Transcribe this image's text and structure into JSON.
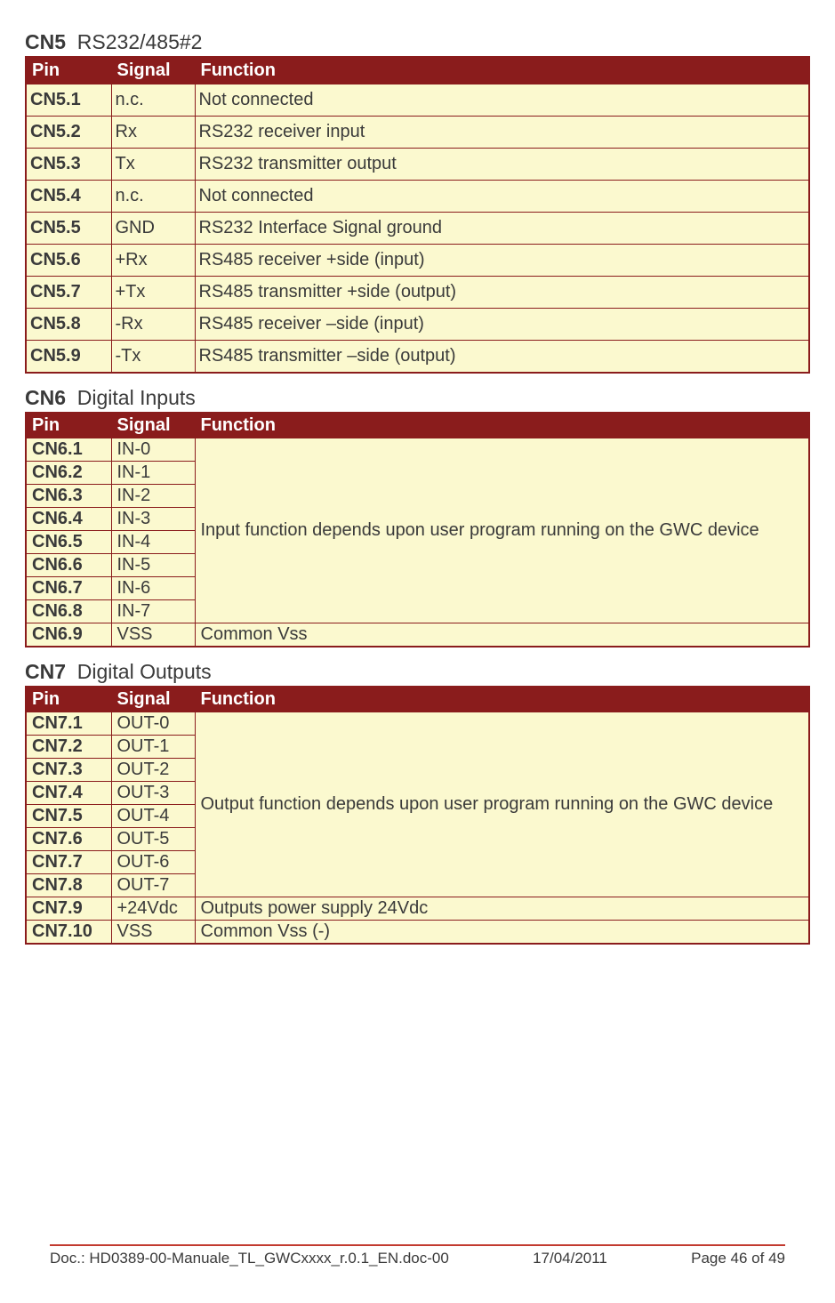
{
  "cn5": {
    "title_bold": "CN5",
    "title_rest": "RS232/485#2",
    "headers": {
      "pin": "Pin",
      "signal": "Signal",
      "func": "Function"
    },
    "rows": [
      {
        "pin": "CN5.1",
        "signal": "n.c.",
        "func": "Not connected"
      },
      {
        "pin": "CN5.2",
        "signal": "Rx",
        "func": "RS232 receiver input"
      },
      {
        "pin": "CN5.3",
        "signal": "Tx",
        "func": "RS232 transmitter output"
      },
      {
        "pin": "CN5.4",
        "signal": "n.c.",
        "func": "Not connected"
      },
      {
        "pin": "CN5.5",
        "signal": "GND",
        "func": "RS232 Interface Signal ground"
      },
      {
        "pin": "CN5.6",
        "signal": "+Rx",
        "func": "RS485 receiver +side (input)"
      },
      {
        "pin": "CN5.7",
        "signal": "+Tx",
        "func": "RS485 transmitter +side (output)"
      },
      {
        "pin": "CN5.8",
        "signal": "-Rx",
        "func": "RS485 receiver  –side (input)"
      },
      {
        "pin": "CN5.9",
        "signal": "-Tx",
        "func": "RS485 transmitter –side (output)"
      }
    ]
  },
  "cn6": {
    "title_bold": "CN6",
    "title_rest": "Digital Inputs",
    "headers": {
      "pin": "Pin",
      "signal": "Signal",
      "func": "Function"
    },
    "merged_func": "Input function depends upon user program running on the GWC device",
    "rows": [
      {
        "pin": "CN6.1",
        "signal": "IN-0"
      },
      {
        "pin": "CN6.2",
        "signal": "IN-1"
      },
      {
        "pin": "CN6.3",
        "signal": "IN-2"
      },
      {
        "pin": "CN6.4",
        "signal": "IN-3"
      },
      {
        "pin": "CN6.5",
        "signal": "IN-4"
      },
      {
        "pin": "CN6.6",
        "signal": "IN-5"
      },
      {
        "pin": "CN6.7",
        "signal": "IN-6"
      },
      {
        "pin": "CN6.8",
        "signal": "IN-7"
      }
    ],
    "last": {
      "pin": "CN6.9",
      "signal": "VSS",
      "func": "Common Vss"
    }
  },
  "cn7": {
    "title_bold": "CN7",
    "title_rest": "Digital Outputs",
    "headers": {
      "pin": "Pin",
      "signal": "Signal",
      "func": "Function"
    },
    "merged_func": "Output function depends upon user program running on the GWC device",
    "rows": [
      {
        "pin": "CN7.1",
        "signal": "OUT-0"
      },
      {
        "pin": "CN7.2",
        "signal": "OUT-1"
      },
      {
        "pin": "CN7.3",
        "signal": "OUT-2"
      },
      {
        "pin": "CN7.4",
        "signal": "OUT-3"
      },
      {
        "pin": "CN7.5",
        "signal": "OUT-4"
      },
      {
        "pin": "CN7.6",
        "signal": "OUT-5"
      },
      {
        "pin": "CN7.7",
        "signal": "OUT-6"
      },
      {
        "pin": "CN7.8",
        "signal": "OUT-7"
      }
    ],
    "tail": [
      {
        "pin": "CN7.9",
        "signal": "+24Vdc",
        "func": "Outputs power supply 24Vdc"
      },
      {
        "pin": "CN7.10",
        "signal": "VSS",
        "func": "Common Vss (-)"
      }
    ]
  },
  "footer": {
    "doc": "Doc.: HD0389-00-Manuale_TL_GWCxxxx_r.0.1_EN.doc-00",
    "date": "17/04/2011",
    "page": "Page 46 of 49"
  }
}
